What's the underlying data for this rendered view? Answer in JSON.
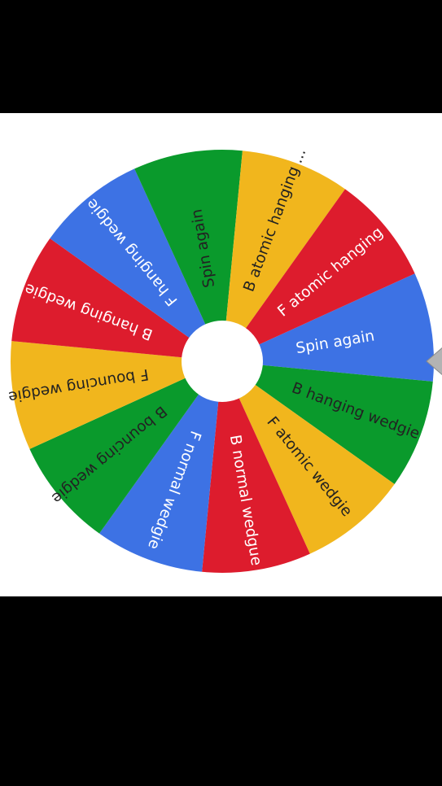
{
  "wheel": {
    "colors": {
      "green": "#0a9a2c",
      "yellow": "#f1b61d",
      "red": "#dd1c2d",
      "blue": "#3d72e4",
      "hub": "#ffffff",
      "pointer": "#b3b3b3"
    },
    "segments": [
      {
        "label": "Spin again",
        "color": "blue",
        "text_color": "#ffffff"
      },
      {
        "label": "B hanging wedgie",
        "color": "green",
        "text_color": "#222222"
      },
      {
        "label": "F atomic wedgie",
        "color": "yellow",
        "text_color": "#222222"
      },
      {
        "label": "B normal wedgue",
        "color": "red",
        "text_color": "#ffffff"
      },
      {
        "label": "F normal wedgie",
        "color": "blue",
        "text_color": "#ffffff"
      },
      {
        "label": "B bouncing wedgie",
        "color": "green",
        "text_color": "#222222"
      },
      {
        "label": "F bouncing wedgie",
        "color": "yellow",
        "text_color": "#222222"
      },
      {
        "label": "B hanging wedgie",
        "color": "red",
        "text_color": "#ffffff"
      },
      {
        "label": "F hanging wedgie",
        "color": "blue",
        "text_color": "#ffffff"
      },
      {
        "label": "Spin again",
        "color": "green",
        "text_color": "#222222"
      },
      {
        "label": "B atomic hanging ...",
        "color": "yellow",
        "text_color": "#222222"
      },
      {
        "label": "F atomic hanging ...",
        "color": "red",
        "text_color": "#ffffff"
      }
    ]
  }
}
